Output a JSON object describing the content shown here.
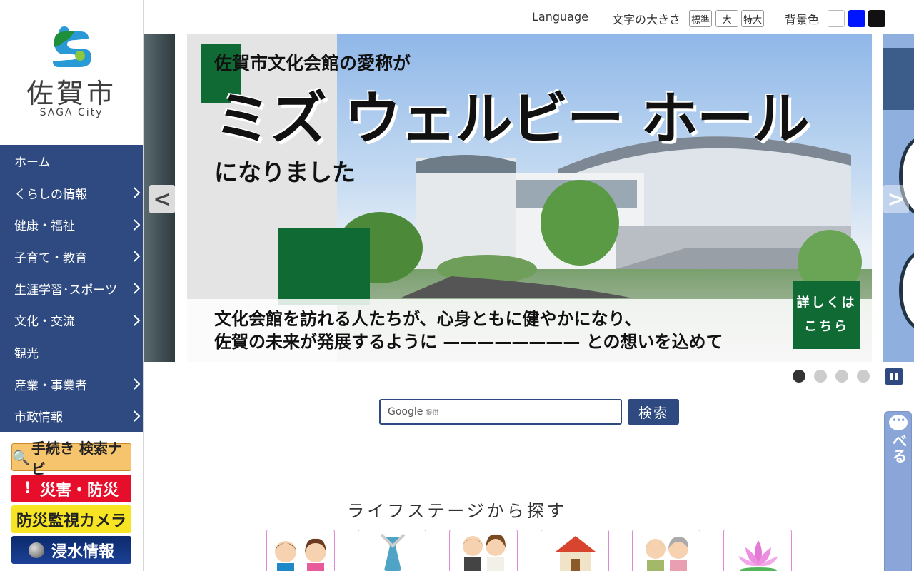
{
  "logo": {
    "name": "佐賀市",
    "sub": "SAGA City"
  },
  "nav": [
    {
      "label": "ホーム",
      "has_sub": false
    },
    {
      "label": "くらしの情報",
      "has_sub": true
    },
    {
      "label": "健康・福祉",
      "has_sub": true
    },
    {
      "label": "子育て・教育",
      "has_sub": true
    },
    {
      "label": "生涯学習･スポーツ",
      "has_sub": true
    },
    {
      "label": "文化・交流",
      "has_sub": true
    },
    {
      "label": "観光",
      "has_sub": false
    },
    {
      "label": "産業・事業者",
      "has_sub": true
    },
    {
      "label": "市政情報",
      "has_sub": true
    }
  ],
  "side_buttons": {
    "navi": "手続き 検索ナビ",
    "disaster": "災害・防災",
    "camera": "防災監視カメラ",
    "flood": "浸水情報"
  },
  "utility": {
    "language": "Language",
    "font_size_label": "文字の大きさ",
    "size_standard": "標準",
    "size_large": "大",
    "size_xlarge": "特大",
    "bg_label": "背景色",
    "colors": {
      "white": "#ffffff",
      "blue": "#0015ff",
      "black": "#111111"
    }
  },
  "slide": {
    "line1": "佐賀市文化会館の愛称が",
    "name": "ミズ ウェルビー ホール",
    "line3": "になりました",
    "line4": "文化会館を訪れる人たちが、心身ともに健やかになり、",
    "line5": "佐賀の未来が発展するように ———————— との想いを込めて",
    "details_1": "詳しくは",
    "details_2": "こちら"
  },
  "carousel": {
    "prev": "<",
    "next": ">",
    "active_dot": 0,
    "dot_count": 4
  },
  "search": {
    "provider": "Google",
    "provider_note": "提供",
    "button": "検索"
  },
  "life_stage": {
    "title": "ライフステージから探す"
  },
  "chatbot": {
    "label": "チャットボットで調べる"
  },
  "theme": {
    "nav_blue": "#2e4a80",
    "green": "#0f6b33"
  }
}
